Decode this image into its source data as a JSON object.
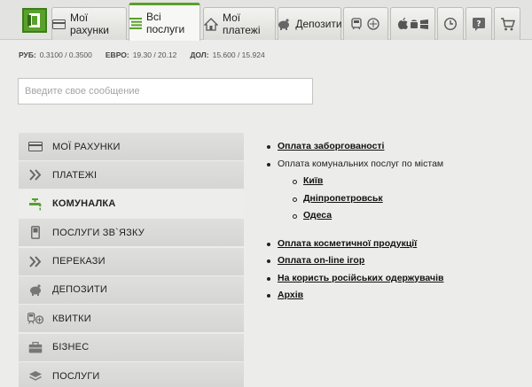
{
  "tabs": {
    "accounts": "Мої рахунки",
    "all_services": "Всі послуги",
    "payments": "Мої платежі",
    "deposits": "Депозити"
  },
  "rates": {
    "rub_label": "РУБ:",
    "rub_value": "0.3100 / 0.3500",
    "eur_label": "ЕВРО:",
    "eur_value": "19.30 / 20.12",
    "usd_label": "ДОЛ:",
    "usd_value": "15.600 / 15.924"
  },
  "message": {
    "placeholder": "Введите свое сообщение"
  },
  "menu": [
    {
      "label": "МОЇ РАХУНКИ",
      "icon": "card-icon"
    },
    {
      "label": "ПЛАТЕЖІ",
      "icon": "double-chevron-icon"
    },
    {
      "label": "КОМУНАЛКА",
      "icon": "faucet-icon"
    },
    {
      "label": "ПОСЛУГИ ЗВ`ЯЗКУ",
      "icon": "phone-icon"
    },
    {
      "label": "ПЕРЕКАЗИ",
      "icon": "double-chevron-icon"
    },
    {
      "label": "ДЕПОЗИТИ",
      "icon": "piggy-bank-icon"
    },
    {
      "label": "КВИТКИ",
      "icon": "train-plane-icon"
    },
    {
      "label": "БІЗНЕС",
      "icon": "briefcase-icon"
    },
    {
      "label": "ПОСЛУГИ",
      "icon": "layers-icon"
    }
  ],
  "links": {
    "debt": "Оплата заборгованості",
    "utilities": "Оплата комунальних послуг по містам",
    "kyiv": "Київ",
    "dnipro": "Дніпропетровськ",
    "odesa": "Одеса",
    "cosmetics": "Оплата косметичної продукції",
    "games": "Оплата on-line ігор",
    "russian": "На користь російських одержувачів",
    "archive": "Архів"
  },
  "colors": {
    "brand_green": "#5aa02c",
    "active_tab_border": "#5aa02c"
  }
}
